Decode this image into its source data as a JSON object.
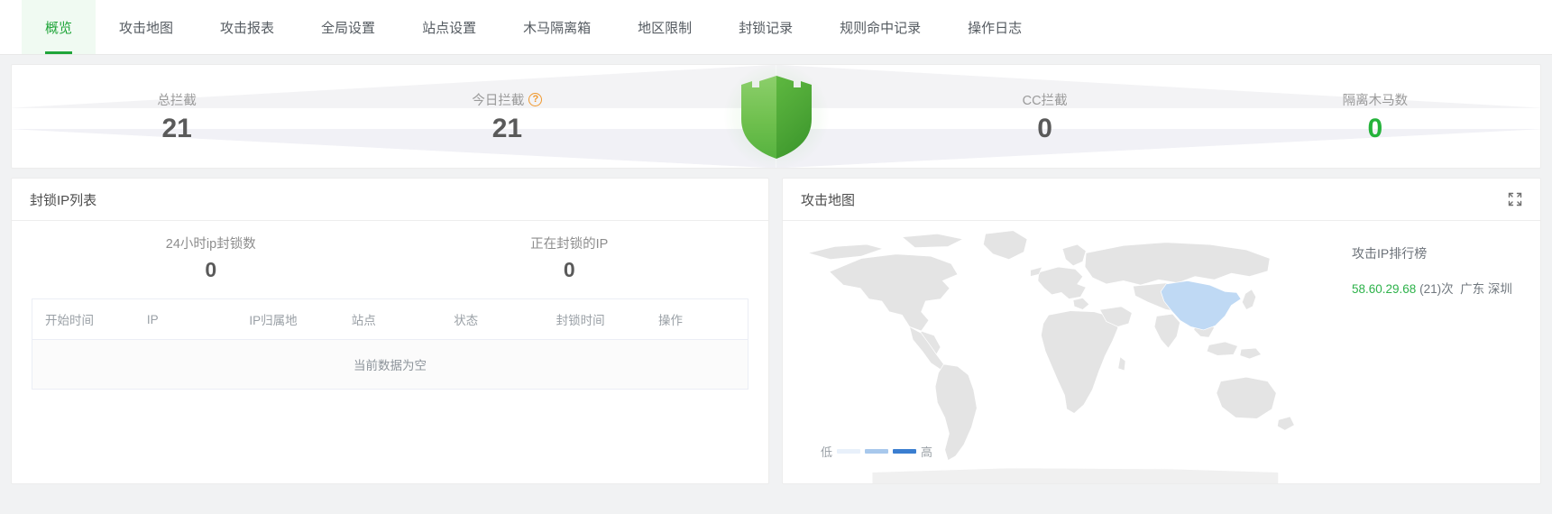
{
  "tabs": [
    {
      "label": "概览",
      "active": true
    },
    {
      "label": "攻击地图",
      "active": false
    },
    {
      "label": "攻击报表",
      "active": false
    },
    {
      "label": "全局设置",
      "active": false
    },
    {
      "label": "站点设置",
      "active": false
    },
    {
      "label": "木马隔离箱",
      "active": false
    },
    {
      "label": "地区限制",
      "active": false
    },
    {
      "label": "封锁记录",
      "active": false
    },
    {
      "label": "规则命中记录",
      "active": false
    },
    {
      "label": "操作日志",
      "active": false
    }
  ],
  "stats": {
    "total_block": {
      "label": "总拦截",
      "value": "21"
    },
    "today_block": {
      "label": "今日拦截",
      "value": "21",
      "help": "?"
    },
    "cc_block": {
      "label": "CC拦截",
      "value": "0"
    },
    "quarantined": {
      "label": "隔离木马数",
      "value": "0"
    }
  },
  "ip_panel": {
    "title": "封锁IP列表",
    "mini_stats": [
      {
        "label": "24小时ip封锁数",
        "value": "0"
      },
      {
        "label": "正在封锁的IP",
        "value": "0"
      }
    ],
    "columns": [
      "开始时间",
      "IP",
      "IP归属地",
      "站点",
      "状态",
      "封锁时间",
      "操作"
    ],
    "rows": [],
    "empty_text": "当前数据为空"
  },
  "map_panel": {
    "title": "攻击地图",
    "expand_icon": "fullscreen-icon",
    "legend": {
      "low": "低",
      "high": "高",
      "colors": [
        "#e8f0fa",
        "#a8c8ec",
        "#3a7ed0"
      ]
    },
    "highlight_country": "China",
    "rank": {
      "title": "攻击IP排行榜",
      "items": [
        {
          "ip": "58.60.29.68",
          "count": "(21)次",
          "region": "广东 深圳"
        }
      ]
    }
  },
  "colors": {
    "accent_green": "#20a53a",
    "value_green": "#25b33b",
    "help_orange": "#f0982d",
    "map_land": "#e4e4e4",
    "map_highlight": "#bfd9f4"
  }
}
